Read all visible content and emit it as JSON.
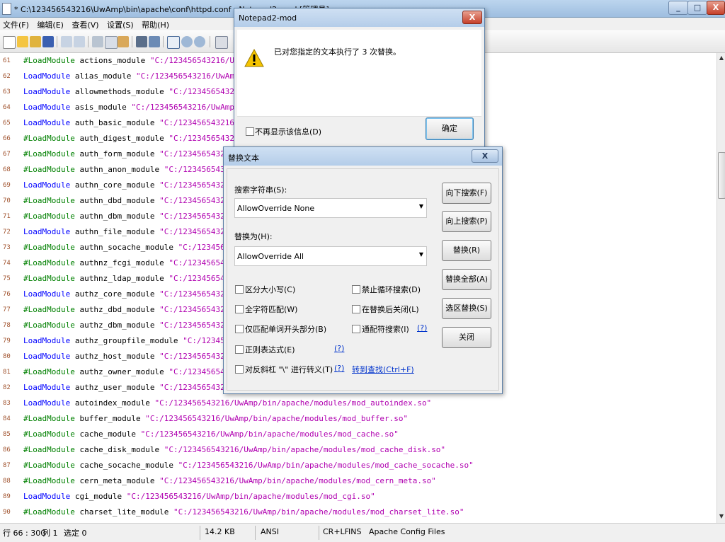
{
  "window": {
    "title": "* C:\\123456543216\\UwAmp\\bin\\apache\\conf\\httpd.conf - Notepad2-mod [管理员]",
    "caption_buttons": [
      "_",
      "□",
      "X"
    ]
  },
  "menu": [
    "文件(F)",
    "编辑(E)",
    "查看(V)",
    "设置(S)",
    "帮助(H)"
  ],
  "editor": {
    "lines": [
      {
        "n": "61",
        "kw": "#LoadModule",
        "mod": "actions_module",
        "path": "\"C:/123456543216/UwAmp/bin/apache/modules/mod_actions.so\""
      },
      {
        "n": "62",
        "kw": "LoadModule",
        "mod": "alias_module",
        "path": "\"C:/123456543216/UwAmp/bin/apache/modules/mod_alias.so\""
      },
      {
        "n": "63",
        "kw": "LoadModule",
        "mod": "allowmethods_module",
        "path": "\"C:/123456543216/UwAmp/bin/apache/modules/mod_allowmethods.so\""
      },
      {
        "n": "64",
        "kw": "LoadModule",
        "mod": "asis_module",
        "path": "\"C:/123456543216/UwAmp/bin/apache/modules/mod_asis.so\""
      },
      {
        "n": "65",
        "kw": "LoadModule",
        "mod": "auth_basic_module",
        "path": "\"C:/123456543216/UwAmp/bin/apache/modules/mod_auth_basic.so\""
      },
      {
        "n": "66",
        "kw": "#LoadModule",
        "mod": "auth_digest_module",
        "path": "\"C:/123456543216/UwAmp/bin/apache/modules/mod_auth_digest.so\""
      },
      {
        "n": "67",
        "kw": "#LoadModule",
        "mod": "auth_form_module",
        "path": "\"C:/123456543216/UwAmp/bin/apache/modules/mod_auth_form.so\""
      },
      {
        "n": "68",
        "kw": "#LoadModule",
        "mod": "authn_anon_module",
        "path": "\"C:/123456543216/UwAmp/bin/apache/modules/mod_authn_anon.so\""
      },
      {
        "n": "69",
        "kw": "LoadModule",
        "mod": "authn_core_module",
        "path": "\"C:/123456543216/UwAmp/bin/apache/modules/mod_authn_core.so\""
      },
      {
        "n": "70",
        "kw": "#LoadModule",
        "mod": "authn_dbd_module",
        "path": "\"C:/123456543216/UwAmp/bin/apache/modules/mod_authn_dbd.so\""
      },
      {
        "n": "71",
        "kw": "#LoadModule",
        "mod": "authn_dbm_module",
        "path": "\"C:/123456543216/UwAmp/bin/apache/modules/mod_authn_dbm.so\""
      },
      {
        "n": "72",
        "kw": "LoadModule",
        "mod": "authn_file_module",
        "path": "\"C:/123456543216/UwAmp/bin/apache/modules/mod_authn_file.so\""
      },
      {
        "n": "73",
        "kw": "#LoadModule",
        "mod": "authn_socache_module",
        "path": "\"C:/123456543216/UwAmp/bin/apache/modules/mod_authn_socache.so\""
      },
      {
        "n": "74",
        "kw": "#LoadModule",
        "mod": "authnz_fcgi_module",
        "path": "\"C:/123456543216/UwAmp/bin/apache/modules/mod_authnz_fcgi.so\""
      },
      {
        "n": "75",
        "kw": "#LoadModule",
        "mod": "authnz_ldap_module",
        "path": "\"C:/123456543216/UwAmp/bin/apache/modules/mod_authnz_ldap.so\""
      },
      {
        "n": "76",
        "kw": "LoadModule",
        "mod": "authz_core_module",
        "path": "\"C:/123456543216/UwAmp/bin/apache/modules/mod_authz_core.so\""
      },
      {
        "n": "77",
        "kw": "#LoadModule",
        "mod": "authz_dbd_module",
        "path": "\"C:/123456543216/UwAmp/bin/apache/modules/mod_authz_dbd.so\""
      },
      {
        "n": "78",
        "kw": "#LoadModule",
        "mod": "authz_dbm_module",
        "path": "\"C:/123456543216/UwAmp/bin/apache/modules/mod_authz_dbm.so\""
      },
      {
        "n": "79",
        "kw": "LoadModule",
        "mod": "authz_groupfile_module",
        "path": "\"C:/123456543216/UwAmp/bin/apache/modules/mod_authz_groupfile.so\""
      },
      {
        "n": "80",
        "kw": "LoadModule",
        "mod": "authz_host_module",
        "path": "\"C:/123456543216/UwAmp/bin/apache/modules/mod_authz_host.so\""
      },
      {
        "n": "81",
        "kw": "#LoadModule",
        "mod": "authz_owner_module",
        "path": "\"C:/123456543216/UwAmp/bin/apache/modules/mod_authz_owner.so\""
      },
      {
        "n": "82",
        "kw": "LoadModule",
        "mod": "authz_user_module",
        "path": "\"C:/123456543216/UwAmp/bin/apache/modules/mod_authz_user.so\""
      },
      {
        "n": "83",
        "kw": "LoadModule",
        "mod": "autoindex_module",
        "path": "\"C:/123456543216/UwAmp/bin/apache/modules/mod_autoindex.so\""
      },
      {
        "n": "84",
        "kw": "#LoadModule",
        "mod": "buffer_module",
        "path": "\"C:/123456543216/UwAmp/bin/apache/modules/mod_buffer.so\""
      },
      {
        "n": "85",
        "kw": "#LoadModule",
        "mod": "cache_module",
        "path": "\"C:/123456543216/UwAmp/bin/apache/modules/mod_cache.so\""
      },
      {
        "n": "86",
        "kw": "#LoadModule",
        "mod": "cache_disk_module",
        "path": "\"C:/123456543216/UwAmp/bin/apache/modules/mod_cache_disk.so\""
      },
      {
        "n": "87",
        "kw": "#LoadModule",
        "mod": "cache_socache_module",
        "path": "\"C:/123456543216/UwAmp/bin/apache/modules/mod_cache_socache.so\""
      },
      {
        "n": "88",
        "kw": "#LoadModule",
        "mod": "cern_meta_module",
        "path": "\"C:/123456543216/UwAmp/bin/apache/modules/mod_cern_meta.so\""
      },
      {
        "n": "89",
        "kw": "LoadModule",
        "mod": "cgi_module",
        "path": "\"C:/123456543216/UwAmp/bin/apache/modules/mod_cgi.so\""
      },
      {
        "n": "90",
        "kw": "#LoadModule",
        "mod": "charset_lite_module",
        "path": "\"C:/123456543216/UwAmp/bin/apache/modules/mod_charset_lite.so\""
      }
    ]
  },
  "status": {
    "position": "行 66 : 300",
    "column": "列 1",
    "selection": "选定 0",
    "size": "14.2 KB",
    "encoding": "ANSI",
    "line_ending": "CR+LF",
    "mode": "INS",
    "scheme": "Apache Config Files"
  },
  "message_dialog": {
    "title": "Notepad2-mod",
    "message": "已对您指定的文本执行了 3 次替换。",
    "checkbox_label": "不再显示该信息(D)",
    "ok_label": "确定",
    "close_glyph": "X"
  },
  "replace_dialog": {
    "title": "替换文本",
    "close_glyph": "X",
    "search_label": "搜索字符串(S):",
    "search_value": "AllowOverride None",
    "replace_label": "替换为(H):",
    "replace_value": "AllowOverride All",
    "options_left": [
      "区分大小写(C)",
      "全字符匹配(W)",
      "仅匹配单词开头部分(B)",
      "正则表达式(E)",
      "对反斜杠 \"\\\" 进行转义(T)"
    ],
    "options_right": [
      "禁止循环搜索(D)",
      "在替换后关闭(L)",
      "通配符搜索(I)"
    ],
    "help_link": "(?)",
    "goto_find_link": "转到查找(Ctrl+F)",
    "buttons": [
      "向下搜索(F)",
      "向上搜索(P)",
      "替换(R)",
      "替换全部(A)",
      "选区替换(S)",
      "关闭"
    ]
  }
}
